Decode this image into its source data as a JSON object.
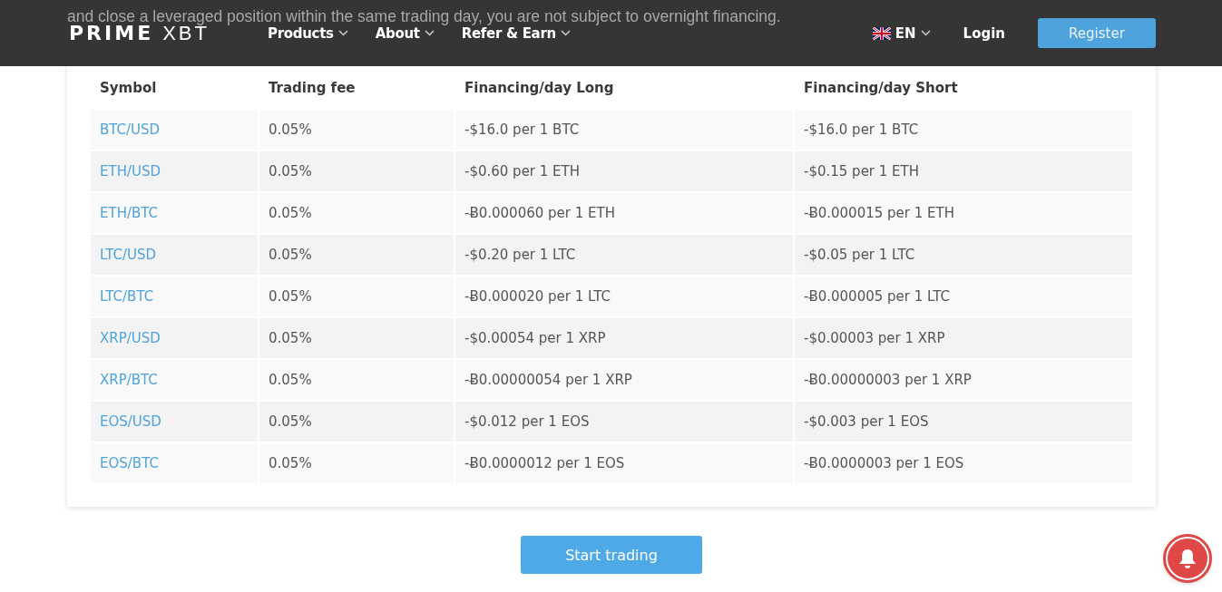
{
  "intro": {
    "text": "and close a leveraged position within the same trading day, you are not subject to overnight financing."
  },
  "header": {
    "logo": {
      "bold": "PRIME",
      "light": "XBT"
    },
    "nav": [
      {
        "label": "Products"
      },
      {
        "label": "About"
      },
      {
        "label": "Refer & Earn"
      }
    ],
    "language": "EN",
    "login": "Login",
    "register": "Register"
  },
  "table": {
    "columns": [
      "Symbol",
      "Trading fee",
      "Financing/day Long",
      "Financing/day Short"
    ],
    "rows": [
      [
        "BTC/USD",
        "0.05%",
        "-$16.0 per 1 BTC",
        "-$16.0 per 1 BTC"
      ],
      [
        "ETH/USD",
        "0.05%",
        "-$0.60 per 1 ETH",
        "-$0.15 per 1 ETH"
      ],
      [
        "ETH/BTC",
        "0.05%",
        "-Ƀ0.000060 per 1 ETH",
        "-Ƀ0.000015 per 1 ETH"
      ],
      [
        "LTC/USD",
        "0.05%",
        "-$0.20 per 1 LTC",
        "-$0.05 per 1 LTC"
      ],
      [
        "LTC/BTC",
        "0.05%",
        "-Ƀ0.000020 per 1 LTC",
        "-Ƀ0.000005 per 1 LTC"
      ],
      [
        "XRP/USD",
        "0.05%",
        "-$0.00054 per 1 XRP",
        "-$0.00003 per 1 XRP"
      ],
      [
        "XRP/BTC",
        "0.05%",
        "-Ƀ0.00000054 per 1 XRP",
        "-Ƀ0.00000003 per 1 XRP"
      ],
      [
        "EOS/USD",
        "0.05%",
        "-$0.012 per 1 EOS",
        "-$0.003 per 1 EOS"
      ],
      [
        "EOS/BTC",
        "0.05%",
        "-Ƀ0.0000012 per 1 EOS",
        "-Ƀ0.0000003 per 1 EOS"
      ]
    ]
  },
  "cta": {
    "label": "Start trading"
  }
}
